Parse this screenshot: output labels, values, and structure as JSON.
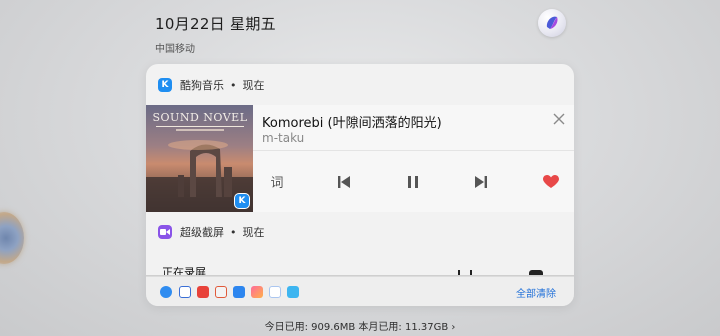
{
  "status": {
    "date": "10月22日 星期五",
    "carrier": "中国移动"
  },
  "notifications": [
    {
      "app": "酷狗音乐",
      "time": "现在",
      "icon": "kugou-music-icon",
      "song_title": "Komorebi (叶隙间洒落的阳光)",
      "artist": "m-taku",
      "album_art_text": "SOUND NOVEL",
      "lyric_button": "词",
      "liked": true
    },
    {
      "app": "超级截屏",
      "time": "现在",
      "icon": "super-screenshot-icon",
      "body": "正在录屏"
    }
  ],
  "footer": {
    "clear_all": "全部清除",
    "app_icons": [
      "safari-icon",
      "messages-icon",
      "video-icon",
      "calendar-icon",
      "cloud-icon",
      "gallery-icon",
      "photos-icon",
      "chat-icon"
    ]
  },
  "data_usage": {
    "text": "今日已用: 909.6MB 本月已用: 11.37GB ›"
  },
  "colors": {
    "accent_blue": "#1f6fd8",
    "kugou_blue": "#1f8ef1",
    "capture_purple": "#8a54e8",
    "heart_red": "#e84848"
  }
}
